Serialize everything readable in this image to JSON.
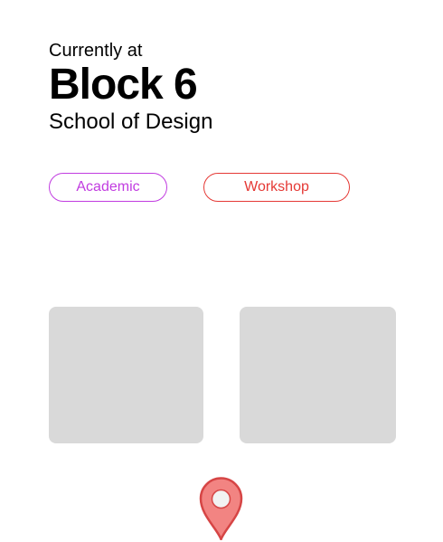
{
  "header": {
    "eyebrow": "Currently at",
    "title": "Block 6",
    "subtitle": "School of Design"
  },
  "tags": [
    {
      "label": "Academic",
      "color": "#c13ce0"
    },
    {
      "label": "Workshop",
      "color": "#e53935"
    }
  ],
  "cards": [
    {
      "color": "#d9d9d9"
    },
    {
      "color": "#d9d9d9"
    }
  ],
  "location_marker": {
    "icon": "map-pin-icon",
    "fill": "#f28482",
    "stroke": "#d64545",
    "center_fill": "#f2f2f2"
  }
}
